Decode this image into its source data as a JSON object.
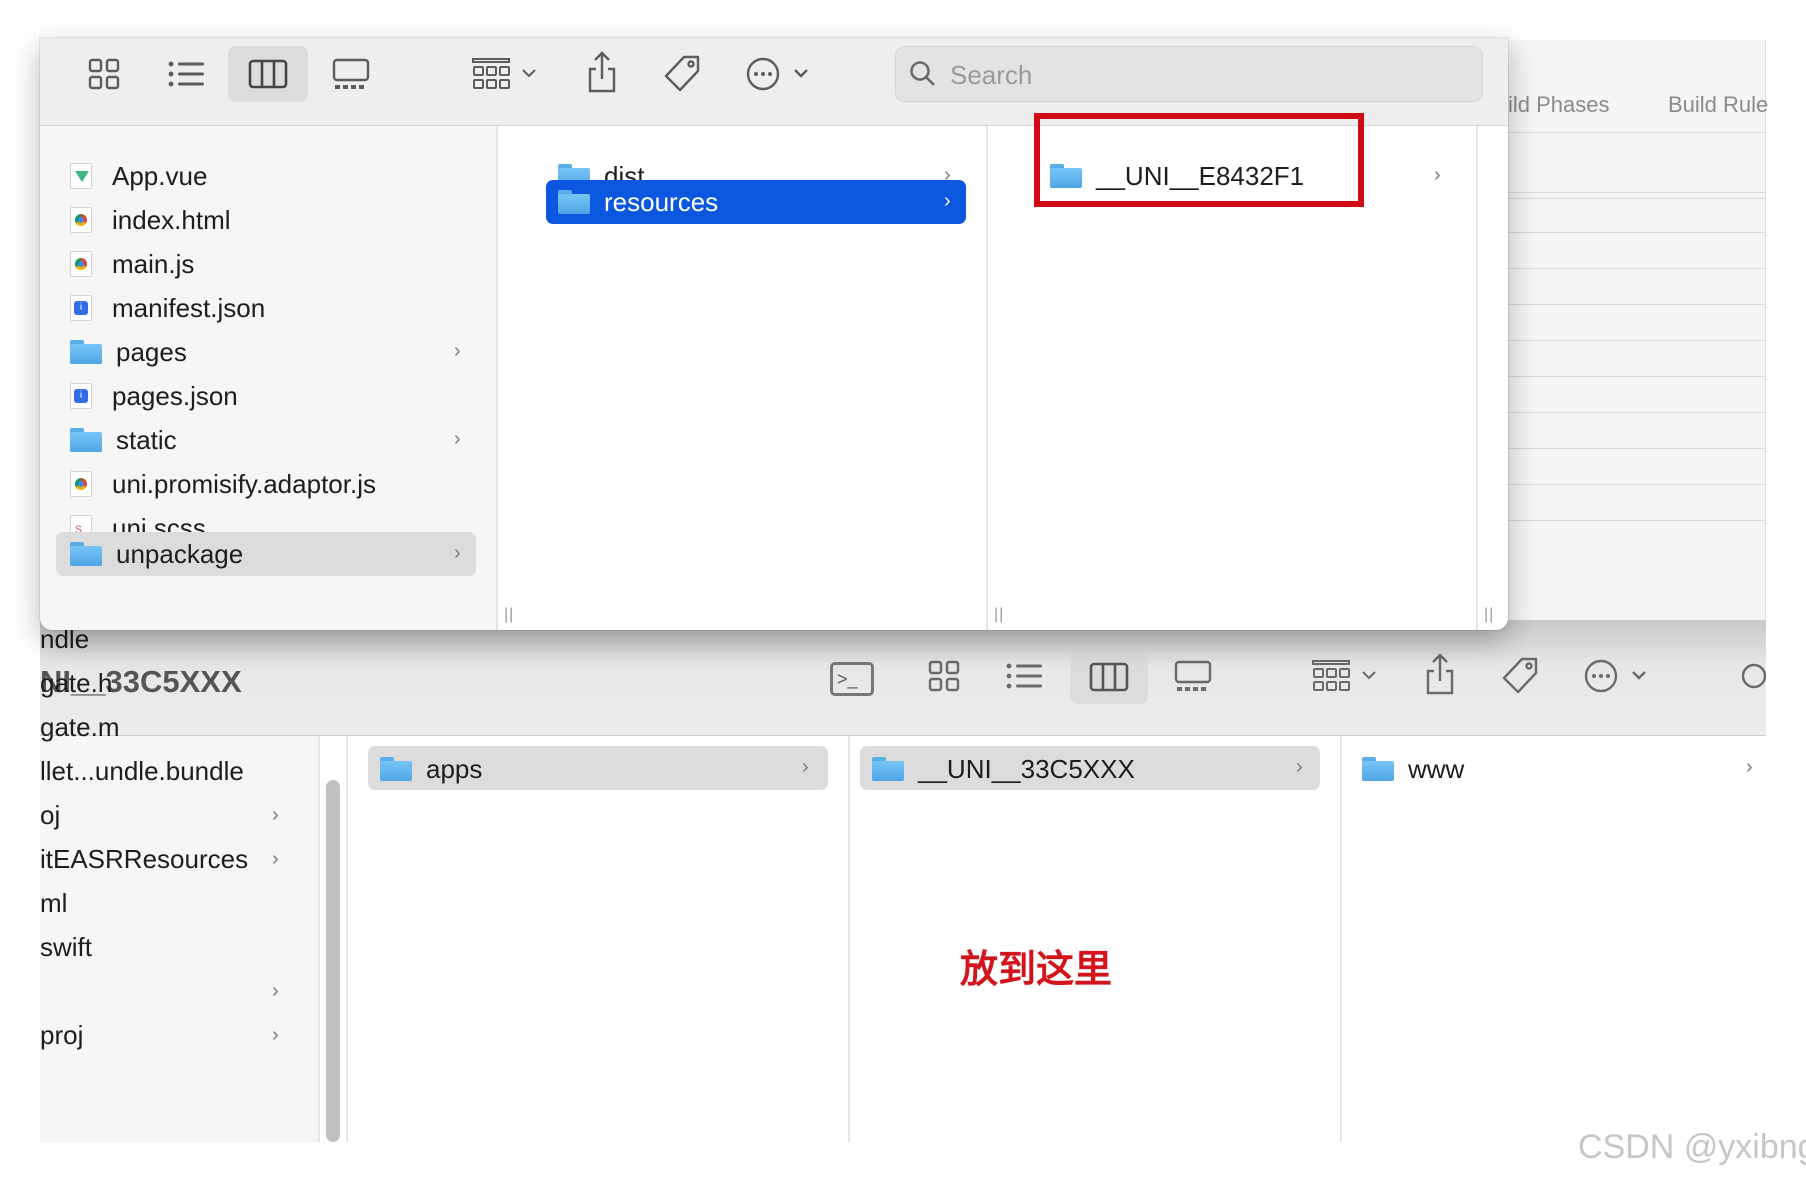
{
  "top_window": {
    "search_placeholder": "Search",
    "columns": [
      {
        "items": [
          {
            "name": "App.vue",
            "icon": "vue-file-icon",
            "type": "file",
            "chevron": false
          },
          {
            "name": "index.html",
            "icon": "chrome-file-icon",
            "type": "file",
            "chevron": false
          },
          {
            "name": "main.js",
            "icon": "chrome-file-icon",
            "type": "file",
            "chevron": false
          },
          {
            "name": "manifest.json",
            "icon": "json-file-icon",
            "type": "file",
            "chevron": false
          },
          {
            "name": "pages",
            "icon": "folder-icon",
            "type": "folder",
            "chevron": true
          },
          {
            "name": "pages.json",
            "icon": "json-file-icon",
            "type": "file",
            "chevron": false
          },
          {
            "name": "static",
            "icon": "folder-icon",
            "type": "folder",
            "chevron": true
          },
          {
            "name": "uni.promisify.adaptor.js",
            "icon": "chrome-file-icon",
            "type": "file",
            "chevron": false
          },
          {
            "name": "uni.scss",
            "icon": "scss-file-icon",
            "type": "file",
            "chevron": false
          },
          {
            "name": "unpackage",
            "icon": "folder-icon",
            "type": "folder",
            "chevron": true,
            "selected": "gray"
          }
        ]
      },
      {
        "items": [
          {
            "name": "dist",
            "icon": "folder-icon",
            "type": "folder",
            "chevron": true
          },
          {
            "name": "resources",
            "icon": "folder-icon",
            "type": "folder",
            "chevron": true,
            "selected": "blue"
          }
        ]
      },
      {
        "items": [
          {
            "name": "__UNI__E8432F1",
            "icon": "folder-icon",
            "type": "folder",
            "chevron": true,
            "highlighted": true
          }
        ]
      }
    ]
  },
  "background_window": {
    "tabs": [
      "ild Phases",
      "Build Rule"
    ]
  },
  "bottom_window": {
    "title": "NI__33C5XXX",
    "sidebar_items": [
      {
        "name": "ndle",
        "chevron": false
      },
      {
        "name": "gate.h",
        "chevron": false
      },
      {
        "name": "gate.m",
        "chevron": false
      },
      {
        "name": "llet...undle.bundle",
        "chevron": false
      },
      {
        "name": "oj",
        "chevron": true
      },
      {
        "name": "itEASRResources",
        "chevron": true
      },
      {
        "name": "ml",
        "chevron": false
      },
      {
        "name": "swift",
        "chevron": false
      },
      {
        "name": "",
        "chevron": true
      },
      {
        "name": "proj",
        "chevron": true
      }
    ],
    "columns": [
      {
        "name": "apps",
        "selected": "gray"
      },
      {
        "name": "__UNI__33C5XXX",
        "selected": "gray"
      },
      {
        "name": "www",
        "selected": "none"
      }
    ]
  },
  "annotation": {
    "text": "放到这里",
    "color": "#d4141c",
    "box_color": "#d00a15"
  },
  "watermark": "CSDN @yxibng",
  "colors": {
    "selection_blue": "#0b57e0",
    "selection_gray": "#dcdcdc",
    "folder_blue": "#5aaee8"
  }
}
